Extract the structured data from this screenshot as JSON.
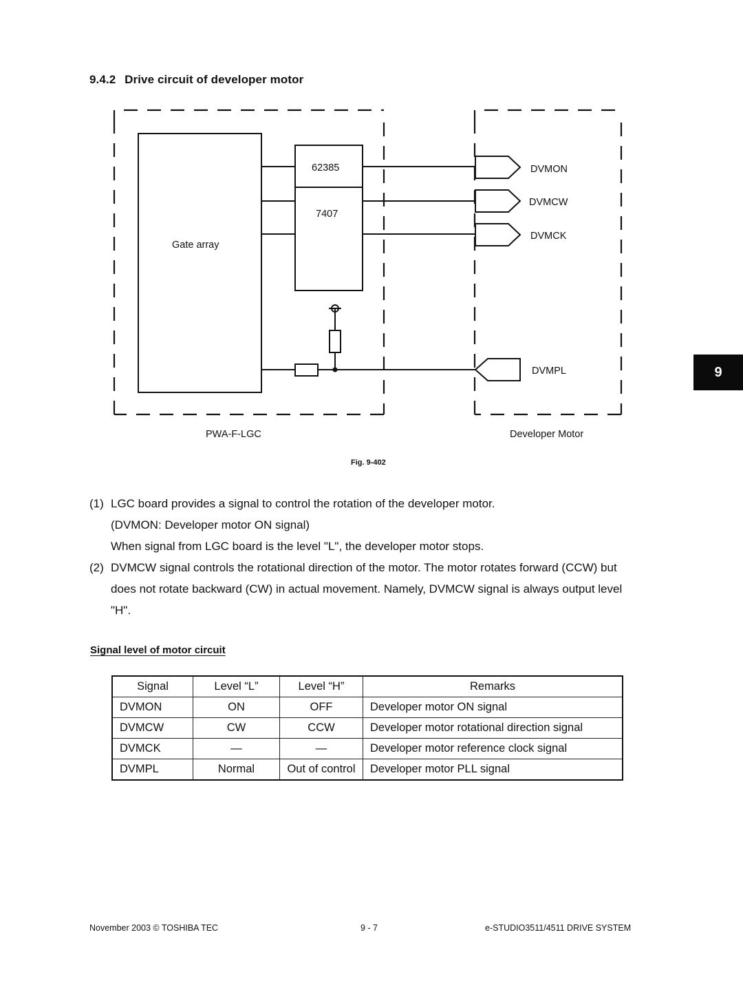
{
  "section": {
    "number": "9.4.2",
    "title": "Drive circuit of developer motor"
  },
  "diagram": {
    "gate_array_label": "Gate array",
    "ic_top_label": "62385",
    "ic_bottom_label": "7407",
    "signals": [
      "DVMON",
      "DVMCW",
      "DVMCK",
      "DVMPL"
    ],
    "board_label": "PWA-F-LGC",
    "motor_label": "Developer Motor"
  },
  "figure_caption": "Fig. 9-402",
  "chapter_tab": "9",
  "paragraphs": [
    {
      "marker": "(1)",
      "lines": [
        "LGC board provides a signal to control the rotation of the developer motor.",
        "(DVMON: Developer motor ON signal)",
        "When signal from LGC board is the level \"L\", the developer motor stops."
      ]
    },
    {
      "marker": "(2)",
      "lines": [
        "DVMCW signal controls the rotational direction of the motor. The motor rotates forward (CCW) but",
        "does not rotate backward (CW) in actual movement. Namely, DVMCW signal is always output level",
        "\"H\"."
      ]
    }
  ],
  "table_title": "Signal level of motor circuit",
  "table": {
    "headers": [
      "Signal",
      "Level “L”",
      "Level “H”",
      "Remarks"
    ],
    "rows": [
      [
        "DVMON",
        "ON",
        "OFF",
        "Developer motor ON signal"
      ],
      [
        "DVMCW",
        "CW",
        "CCW",
        "Developer motor rotational direction signal"
      ],
      [
        "DVMCK",
        "—",
        "—",
        "Developer motor reference clock signal"
      ],
      [
        "DVMPL",
        "Normal",
        "Out of control",
        "Developer motor PLL signal"
      ]
    ]
  },
  "footer": {
    "left": "November 2003 © TOSHIBA TEC",
    "center": "9 - 7",
    "right": "e-STUDIO3511/4511 DRIVE SYSTEM"
  }
}
